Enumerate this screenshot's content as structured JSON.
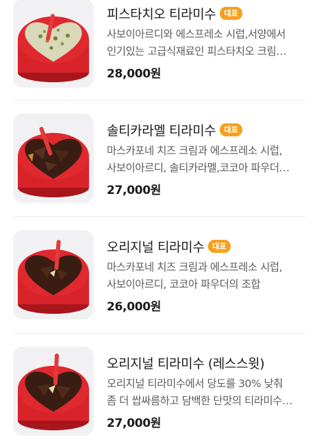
{
  "menu": {
    "items": [
      {
        "name": "피스타치오 티라미수",
        "badge": "대표",
        "desc_line1": "사보이아르디와 에스프레소 시럽,서양에서",
        "desc_line2": "인기있는 고급식재료인 피스타치오 크림…",
        "price": "28,000원",
        "image": "pistachio-tiramisu-image"
      },
      {
        "name": "솔티카라멜 티라미수",
        "badge": "대표",
        "desc_line1": "마스카포네 치즈 크림과 에스프레소 시럽,",
        "desc_line2": "사보이아르디, 솔티카라멜,코코아 파우더…",
        "price": "27,000원",
        "image": "salted-caramel-tiramisu-image"
      },
      {
        "name": "오리지널 티라미수",
        "badge": "대표",
        "desc_line1": "마스카포네 치즈 크림과 에스프레소 시럽,",
        "desc_line2": "사보이아르디, 코코아 파우더의 조합",
        "price": "26,000원",
        "image": "original-tiramisu-image"
      },
      {
        "name": "오리지널 티라미수 (레스스윗)",
        "badge": "",
        "desc_line1": "오리지널 티라미수에서 당도를 30% 낮춰",
        "desc_line2": "좀 더 쌉싸름하고 담백한 단맛의 티라미수…",
        "price": "27,000원",
        "image": "less-sweet-tiramisu-image"
      }
    ]
  },
  "colors": {
    "badge": "#f5a01e",
    "container_red": "#d9232a",
    "cocoa": "#3a1d12",
    "pistachio_cream": "#d9d8b8"
  }
}
